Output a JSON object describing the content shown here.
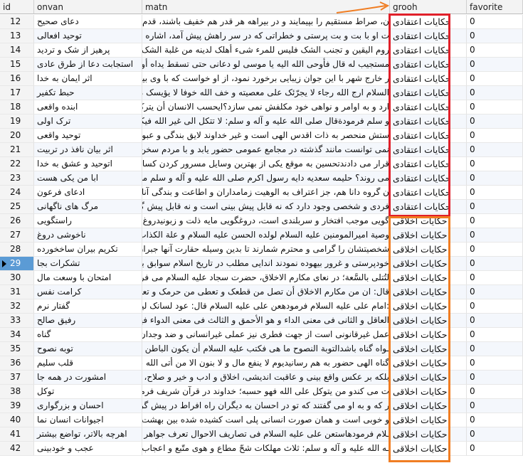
{
  "columns": {
    "id": "id",
    "onvan": "onvan",
    "matn": "matn",
    "grooh": "grooh",
    "favorite": "favorite"
  },
  "selected_row_id": "29",
  "rows": [
    {
      "id": "12",
      "onvan": "دعای صحیح",
      "matn": "ن، صراط مستقیم را بپیمایند و در بیراهه هر قدر هم خفیف باشند، قدم نگذارند",
      "grooh": "حکایات اعتقادی",
      "favorite": "0"
    },
    {
      "id": "13",
      "onvan": "توحید افعالی",
      "matn": "ت او با بت و بت پرستی و خطراتی که در سر راهش پیش آمد، اشاره می نماییم",
      "grooh": "حکایات اعتقادی",
      "favorite": "0"
    },
    {
      "id": "14",
      "onvan": "پرهیز از شک و تردید",
      "matn": "روم الیقین و تجنب الشک فلیس للمرء شیء أهلک لدینه من غلبة الشک علی یقینه؛",
      "grooh": "حکایات اعتقادی",
      "favorite": "0"
    },
    {
      "id": "15",
      "onvan": "استجابت دعا از طرق عادی",
      "matn": "مستجیب له قال فأوحی الله الیه یا موسی لو دعانی حتی تسقط یداه أو تنقطع ید",
      "grooh": "حکایات اعتقادی",
      "favorite": "0"
    },
    {
      "id": "16",
      "onvan": "اثر ایمان به خدا",
      "matn": "ر خارج شهر با این جوان زیبایی برخورد نمود، از او خواست که با وی بیامیزد",
      "grooh": "حکایات اعتقادی",
      "favorite": "0"
    },
    {
      "id": "17",
      "onvan": "حبط تکفیر",
      "matn": "السلام ارج الله رجاء لا یجرّئک علی معصیته و خف الله خوفا لا یؤیسک من رحمته",
      "grooh": "حکایات اعتقادی",
      "favorite": "0"
    },
    {
      "id": "18",
      "onvan": "ابنده واقعی",
      "matn": "ارد و به اوامر و نواهی خود مکلفش نمی سازد؟ایحسب الانسان أن یترک سدی؛",
      "grooh": "حکایات اعتقادی",
      "favorite": "0"
    },
    {
      "id": "19",
      "onvan": "ترک اولی",
      "matn": "و سلم فرمودةقال صلی الله علیه و آله و سلم: لا تتکل الی غیر الله فیکلک الله الیه؛",
      "grooh": "حکایات اعتقادی",
      "favorite": "0"
    },
    {
      "id": "20",
      "onvan": "توحید واقعی",
      "matn": "ستش منحصر به ذات اقدس الهی است و غیر خداوند لایق بندگی و عبودیت نیست",
      "grooh": "حکایات اعتقادی",
      "favorite": "0"
    },
    {
      "id": "21",
      "onvan": "اثر بیان نافذ در تربیت",
      "matn": "نمی توانست مانند گذشته در مجامع عمومی حضور یابد و با مردم سخن بگوید",
      "grooh": "حکایات اعتقادی",
      "favorite": "0"
    },
    {
      "id": "22",
      "onvan": "اتوحید و عشق به خدا",
      "matn": "قرار می دادندتحسین به موقع یکی از بهترین وسایل مسرور کردن کسان است",
      "grooh": "حکایات اعتقادی",
      "favorite": "0"
    },
    {
      "id": "23",
      "onvan": "ابا من یکی هست",
      "matn": "می روند؟ حلیمه سعدیه دایه رسول اکرم صلی الله علیه و آله و سلم می گوید",
      "grooh": "حکایات اعتقادی",
      "favorite": "0"
    },
    {
      "id": "24",
      "onvan": "ادعای فرعون",
      "matn": "ن گروه دانا هم، جز اعتراف به الوهیت زمامداران و اطاعت و بندگی آنان چاره",
      "grooh": "حکایات اعتقادی",
      "favorite": "0"
    },
    {
      "id": "25",
      "onvan": "مرگ های ناگهانی",
      "matn": "فردی و شخصی وجود دارد که نه قابل پیش بینی است و نه قابل پیش گیری",
      "grooh": "حکایات اعتقادی",
      "favorite": "0"
    },
    {
      "id": "26",
      "onvan": "راستگویی",
      "matn": "گویی موجب افتخار و سربلندی است، دروغگویی مایه ذلت و زبونیدروغ گویی",
      "grooh": "حکایات اخلاقی",
      "favorite": "0"
    },
    {
      "id": "27",
      "onvan": "ناخوشی دروغ",
      "matn": "وصیة امیرالمومنین علیه السلام لولده الحسن علیه السلام و علة الکذاب اقبح علة؛",
      "grooh": "حکایات اخلاقی",
      "favorite": "0"
    },
    {
      "id": "28",
      "onvan": "تکریم بیران ساخخورده",
      "matn": "شخصیتشان را گرامی و محترم شمارند تا بدین وسیله حقارت آنها جبران گردد",
      "grooh": "حکایات اخلاقی",
      "favorite": "0"
    },
    {
      "id": "29",
      "onvan": "تشکرات بجا",
      "matn": "خودپرستی و غرور بیهوده نمودند اندایی مطلب در تاریخ اسلام سوابق بسیار دارد",
      "grooh": "حکایات اخلاقی",
      "favorite": "0"
    },
    {
      "id": "30",
      "onvan": "امتحان با وسعت مال",
      "matn": "لتُتلی بالسَّعة؛ در نعاى مکارم الاخلاق، حضرت سجاد علیه السلام می فرماید",
      "grooh": "حکایات اخلاقی",
      "favorite": "0"
    },
    {
      "id": "31",
      "onvan": "کرامت نفس",
      "matn": "قال: ان من مکارم الاخلاق أن تصل من قطعک و تعطی من حرمک و تعفو عمن ظلمک؛",
      "grooh": "حکایات اخلاقی",
      "favorite": "0"
    },
    {
      "id": "32",
      "onvan": "گفتار نرم",
      "matn": ":امام علی علیه السلام فرمودهعن علی علیه السلام قال: عود لسانک لین الکلام؛",
      "grooh": "حکایات اخلاقی",
      "favorite": "0"
    },
    {
      "id": "33",
      "onvan": "رفیق صالح",
      "matn": "العاقل و الثانی فی معنی الداء و هو الأحمق و الثالث فی معنی الدواء فهو الحبیب؛",
      "grooh": "حکایات اخلاقی",
      "favorite": "0"
    },
    {
      "id": "34",
      "onvan": "گناه",
      "matn": "عمل غیرقانونی است از جهت فطری نیز عملی غیرانسانی و ضد وجدان است",
      "grooh": "حکایات اخلاقی",
      "favorite": "0"
    },
    {
      "id": "35",
      "onvan": "توبه نصوح",
      "matn": "ـواه گناه باشدالتوبة النصوح ما هی فکتب علیه السلام أن یکون الباطن کالظاهر؛",
      "grooh": "حکایات اخلاقی",
      "favorite": "0"
    },
    {
      "id": "36",
      "onvan": "قلب سلیم",
      "matn": "گناه الهی حضور به هم رسانیدیوم لا ینفع مال و لا بنون الا من أتی الله بقلب سلیم؛",
      "grooh": "حکایات اخلاقی",
      "favorite": "0"
    },
    {
      "id": "37",
      "onvan": "امشورت در همه جا",
      "matn": "بلکه بر عکس واقع بینی و عاقبت اندیشی، اخلاق و ادب و خیر و صلاح، آنان",
      "grooh": "حکایات اخلاقی",
      "favorite": "0"
    },
    {
      "id": "38",
      "onvan": "توکل",
      "matn": "ت می کندو من یتوکل علی الله فهو حسبه؛ خداوند در قرآن شریف فرموده است",
      "grooh": "حکایات اخلاقی",
      "favorite": "0"
    },
    {
      "id": "39",
      "onvan": "احسان و بزرگواری",
      "matn": "ر که و به او می گفتند که تو در احسان به دیگران راه افراط در پیش گرفته ای",
      "grooh": "حکایات اخلاقی",
      "favorite": "0"
    },
    {
      "id": "40",
      "onvan": "اجیوانات انسان نما",
      "matn": "و خوبی است و همان صورت انسانی پلی است کشیده شده بین بهشت و دوزخ",
      "grooh": "حکایات اخلاقی",
      "favorite": "0"
    },
    {
      "id": "41",
      "onvan": "اهرچه بالاتر، تواضع بیشتر",
      "matn": "ـلام فرمودهاستعن علی علیه السلام فی تصاریف الاحوال تعرف جواهر الرجال؛",
      "grooh": "حکایات اخلاقی",
      "favorite": "0"
    },
    {
      "id": "42",
      "onvan": "عجب و خودبینی",
      "matn": "ـه الله علیه و آله و سلم: ثلاث مهلکات شحّ مطاع و هوی متّبع و اعجاب المرء بنفسه؛",
      "grooh": "حکایات اخلاقی",
      "favorite": "0"
    }
  ],
  "annotations": {
    "red_box_color": "#e0202a",
    "orange_box_color": "#f07d22",
    "arrow_color": "#f07d22"
  }
}
